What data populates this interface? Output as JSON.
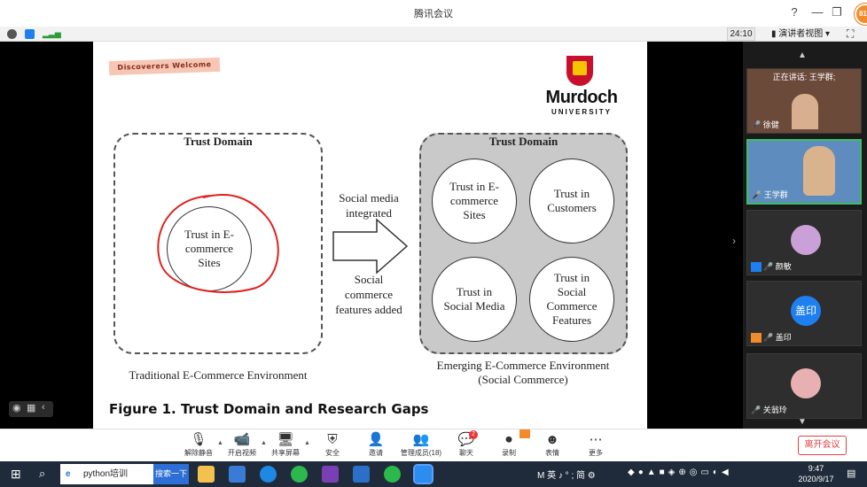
{
  "window": {
    "title": "腾讯会议",
    "avatar_badge": "81"
  },
  "infobar": {
    "timer": "24:10",
    "speaker_view": "演讲者视图"
  },
  "slide": {
    "tag": "Discoverers Welcome",
    "logo_name": "Murdoch",
    "logo_sub": "UNIVERSITY",
    "left_domain_title": "Trust Domain",
    "left_circle": "Trust in E-\ncommerce\nSites",
    "left_caption": "Traditional E-Commerce Environment",
    "arrow_top": "Social media\nintegrated",
    "arrow_bottom": "Social\ncommerce\nfeatures added",
    "right_domain_title": "Trust Domain",
    "right_circles": [
      "Trust in E-\ncommerce\nSites",
      "Trust in\nCustomers",
      "Trust in\nSocial Media",
      "Trust in\nSocial\nCommerce\nFeatures"
    ],
    "right_caption": "Emerging E-Commerce Environment\n(Social Commerce)",
    "figure_title": "Figure 1. Trust Domain and Research Gaps"
  },
  "participants": {
    "speaking": "正在讲话: 王学群;",
    "tiles": [
      {
        "name": "徐健"
      },
      {
        "name": "王学群"
      },
      {
        "name": "颜敏"
      },
      {
        "name": "盖印",
        "avatar_text": "盖印"
      },
      {
        "name": "关翁玲"
      }
    ]
  },
  "toolbar": {
    "buttons": [
      {
        "label": "解除静音",
        "icon": "mic-muted-icon"
      },
      {
        "label": "开启视频",
        "icon": "camera-off-icon"
      },
      {
        "label": "共享屏幕",
        "icon": "share-screen-icon"
      },
      {
        "label": "安全",
        "icon": "shield-icon"
      },
      {
        "label": "邀请",
        "icon": "invite-icon"
      },
      {
        "label": "管理成员(18)",
        "icon": "members-icon"
      },
      {
        "label": "聊天",
        "icon": "chat-icon",
        "badge": "2"
      },
      {
        "label": "录制",
        "icon": "record-icon"
      },
      {
        "label": "表情",
        "icon": "emoji-icon"
      },
      {
        "label": "更多",
        "icon": "more-icon"
      }
    ],
    "leave": "离开会议"
  },
  "taskbar": {
    "search_text": "python培训",
    "search_button": "搜索一下",
    "ime": "M 英 ♪ ° ; 简 ⚙",
    "time": "9:47",
    "date": "2020/9/17"
  },
  "colors": {
    "accent_blue": "#1e7ff0",
    "leave_red": "#e04040",
    "murdoch_red": "#c8102e"
  }
}
